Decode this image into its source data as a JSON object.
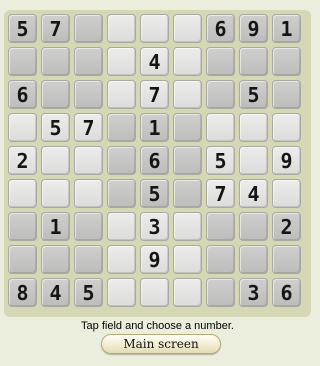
{
  "game": {
    "grid": [
      [
        "5",
        "7",
        "",
        "",
        "",
        "",
        "6",
        "9",
        "1"
      ],
      [
        "",
        "",
        "",
        "",
        "4",
        "",
        "",
        "",
        ""
      ],
      [
        "6",
        "",
        "",
        "",
        "7",
        "",
        "",
        "5",
        ""
      ],
      [
        "",
        "5",
        "7",
        "",
        "1",
        "",
        "",
        "",
        ""
      ],
      [
        "2",
        "",
        "",
        "",
        "6",
        "",
        "5",
        "",
        "9"
      ],
      [
        "",
        "",
        "",
        "",
        "5",
        "",
        "7",
        "4",
        ""
      ],
      [
        "",
        "1",
        "",
        "",
        "3",
        "",
        "",
        "",
        "2"
      ],
      [
        "",
        "",
        "",
        "",
        "9",
        "",
        "",
        "",
        ""
      ],
      [
        "8",
        "4",
        "5",
        "",
        "",
        "",
        "",
        "3",
        "6"
      ]
    ],
    "hint": "Tap field and choose a number.",
    "main_button_label": "Main screen"
  },
  "colors": {
    "background": "#eceedd",
    "board": "#d6d7b5",
    "cell_dark": "#c6c6c4",
    "cell_light": "#e4e4e3",
    "digit": "#151515"
  }
}
